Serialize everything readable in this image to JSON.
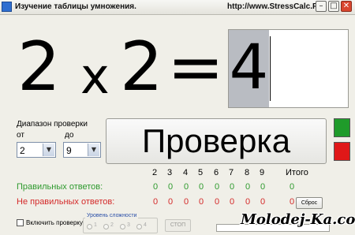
{
  "window": {
    "title": "Изучение таблицы умножения.",
    "url": "http://www.StressCalc.Ru",
    "btn_minimize": "–",
    "btn_maximize": "□",
    "btn_close": "✕"
  },
  "equation": {
    "a": "2",
    "op": "x",
    "b": "2",
    "eq": "=",
    "answer": "4"
  },
  "range": {
    "title": "Диапазон проверки",
    "from_label": "от",
    "to_label": "до",
    "from_value": "2",
    "to_value": "9",
    "dropdown_glyph": "▼"
  },
  "check_button": "Проверка",
  "status_colors": {
    "correct": "#1f9b2a",
    "wrong": "#e01818"
  },
  "stats": {
    "columns": [
      "2",
      "3",
      "4",
      "5",
      "6",
      "7",
      "8",
      "9"
    ],
    "total_label": "Итого",
    "correct_label": "Правильных ответов:",
    "wrong_label": "Не правильных ответов:",
    "correct_values": [
      "0",
      "0",
      "0",
      "0",
      "0",
      "0",
      "0",
      "0"
    ],
    "correct_total": "0",
    "wrong_values": [
      "0",
      "0",
      "0",
      "0",
      "0",
      "0",
      "0",
      "0"
    ],
    "wrong_total": "0"
  },
  "reset_button": "Сброс",
  "include_check_label": "Включить проверку",
  "difficulty": {
    "title": "Уровень сложности",
    "options": [
      "1",
      "2",
      "3",
      "4"
    ]
  },
  "stop_button": "СТОП",
  "watermark": "Molodej-Ka.com"
}
